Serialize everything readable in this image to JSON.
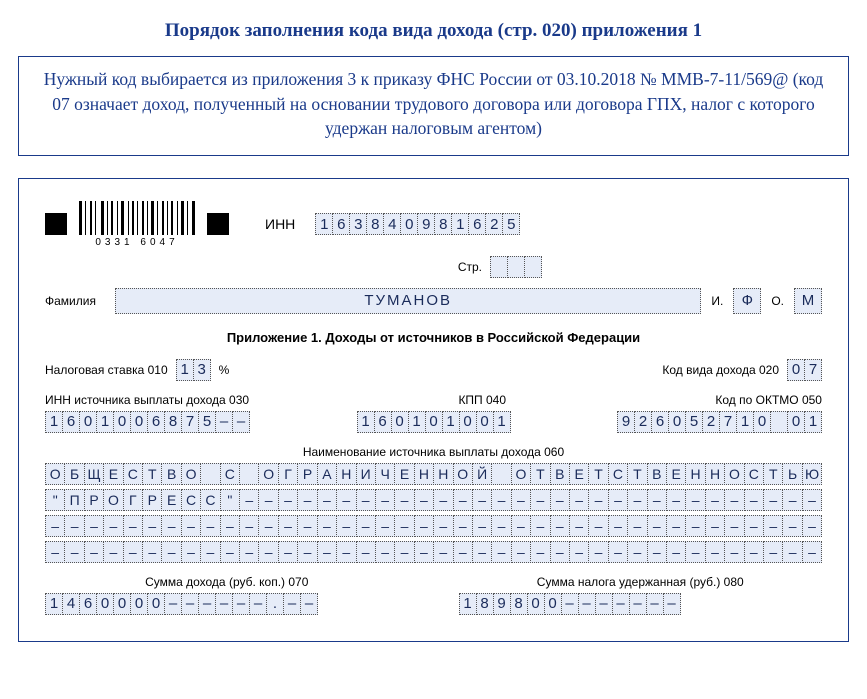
{
  "title": "Порядок заполнения кода вида дохода (стр. 020) приложения 1",
  "note": "Нужный код выбирается из приложения 3 к приказу ФНС России от 03.10.2018 № ММВ-7-11/569@ (код 07 означает доход, полученный на основании трудового договора или договора ГПХ, налог с которого удержан налоговым агентом)",
  "barcode_numbers": "0331   6047",
  "inn_label": "ИНН",
  "inn_value": "163840981625",
  "page_label": "Стр.",
  "page_value": "   ",
  "surname_label": "Фамилия",
  "surname_value": "ТУМАНОВ",
  "initial_i_label": "И.",
  "initial_i_value": "Ф",
  "initial_o_label": "О.",
  "initial_o_value": "М",
  "section_heading": "Приложение 1. Доходы от источников в Российской Федерации",
  "rate_label": "Налоговая ставка   010",
  "rate_value": "13",
  "rate_suffix": "%",
  "income_code_label": "Код вида дохода   020",
  "income_code_value": "07",
  "source_inn_label": "ИНН источника выплаты дохода   030",
  "source_inn_value": "1601006875--",
  "kpp_label": "КПП   040",
  "kpp_value": "160101001",
  "oktmo_label": "Код по ОКТМО   050",
  "oktmo_value": "926052710 01",
  "source_name_label": "Наименование источника выплаты дохода   060",
  "source_name_line1": "ОБЩЕСТВО С ОГРАНИЧЕННОЙ ОТВЕТСТВЕННОСТЬЮ",
  "source_name_line2": "\"ПРОГРЕСС\"------------------------------",
  "source_name_line3": "----------------------------------------",
  "source_name_line4": "----------------------------------------",
  "income_sum_label": "Сумма дохода (руб. коп.)   070",
  "income_sum_value": "1460000------.--",
  "tax_withheld_label": "Сумма налога удержанная (руб.)   080",
  "tax_withheld_value": "189800-------"
}
